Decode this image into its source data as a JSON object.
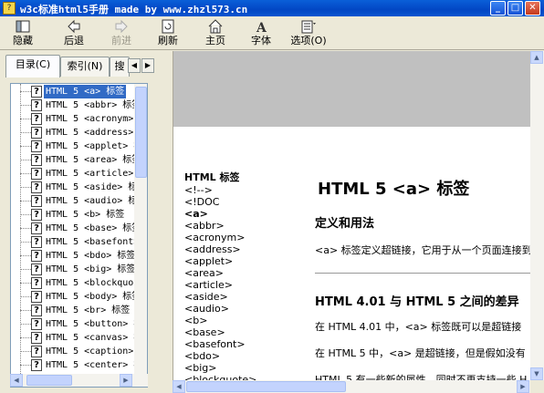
{
  "window": {
    "title": "w3c标准html5手册 made by www.zhzl573.cn",
    "buttons": [
      "minimize",
      "maximize",
      "close"
    ]
  },
  "toolbar": {
    "buttons": [
      {
        "label": "隐藏",
        "icon": "hide-icon",
        "enabled": true
      },
      {
        "label": "后退",
        "icon": "back-arrow-icon",
        "enabled": true
      },
      {
        "label": "前进",
        "icon": "forward-arrow-icon",
        "enabled": false
      },
      {
        "label": "刷新",
        "icon": "refresh-icon",
        "enabled": true
      },
      {
        "label": "主页",
        "icon": "home-icon",
        "enabled": true
      },
      {
        "label": "字体",
        "icon": "font-icon",
        "enabled": true
      },
      {
        "label": "选项(O)",
        "icon": "options-icon",
        "enabled": true
      }
    ]
  },
  "tabs": [
    {
      "label": "目录(C)",
      "active": true
    },
    {
      "label": "索引(N)",
      "active": false
    },
    {
      "label": "搜",
      "active": false
    }
  ],
  "tree": {
    "items": [
      "HTML 5 <a> 标签",
      "HTML 5 <abbr> 标签",
      "HTML 5 <acronym>",
      "HTML 5 <address>",
      "HTML 5 <applet> 标",
      "HTML 5 <area> 标签",
      "HTML 5 <article>",
      "HTML 5 <aside> 标",
      "HTML 5 <audio> 标",
      "HTML 5 <b> 标签",
      "HTML 5 <base> 标签",
      "HTML 5 <basefont>",
      "HTML 5 <bdo> 标签",
      "HTML 5 <big> 标签",
      "HTML 5 <blockquot",
      "HTML 5 <body> 标签",
      "HTML 5 <br> 标签",
      "HTML 5 <button> 标",
      "HTML 5 <canvas> 标",
      "HTML 5 <caption>",
      "HTML 5 <center> 标"
    ],
    "selected_index": 0
  },
  "content": {
    "sidebar_title": "HTML 标签",
    "sidebar_items": [
      "<!-->",
      "<!DOC",
      "<a>",
      "<abbr>",
      "<acronym>",
      "<address>",
      "<applet>",
      "<area>",
      "<article>",
      "<aside>",
      "<audio>",
      "<b>",
      "<base>",
      "<basefont>",
      "<bdo>",
      "<big>",
      "<blockquote>"
    ],
    "sidebar_bold_index": 2,
    "heading": "HTML 5 <a> 标签",
    "section1_title": "定义和用法",
    "section1_text": "<a> 标签定义超链接，它用于从一个页面连接到",
    "section2_title": "HTML 4.01 与  HTML 5 之间的差异",
    "section2_p1": "在  HTML 4.01 中，<a> 标签既可以是超链接",
    "section2_p2": "在  HTML 5 中，<a> 是超链接，但是假如没有",
    "section2_p3": "HTML 5 有一些新的属性，同时不再支持一些 H"
  }
}
